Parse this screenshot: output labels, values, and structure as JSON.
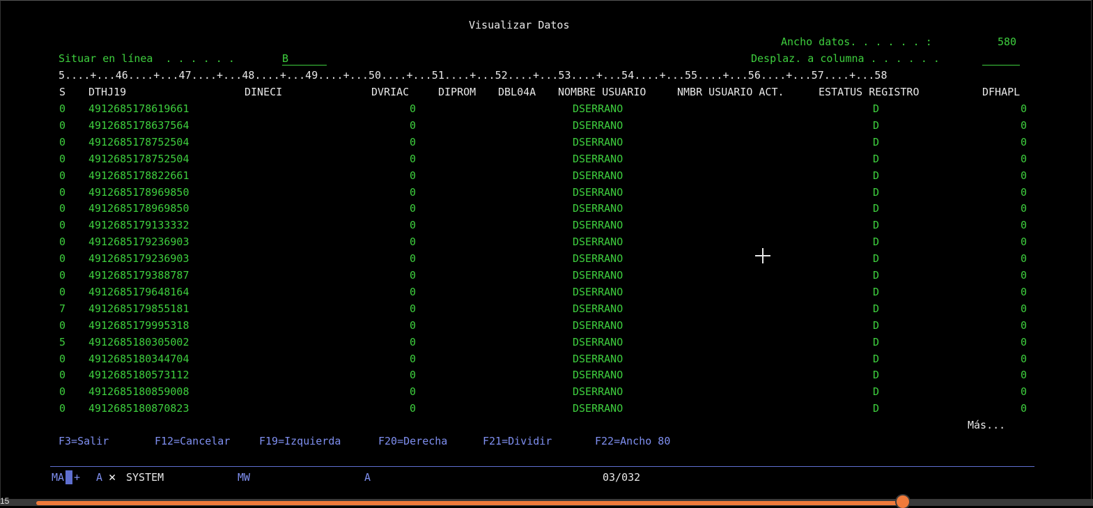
{
  "title": "Visualizar Datos",
  "ancho_label": "Ancho datos. . . . . . :",
  "ancho_value": "580",
  "situar_label": "Situar en línea  . . . . . .",
  "situar_value": "B",
  "desplaz_label": "Desplaz. a columna . . . . . .",
  "ruler": "5....+...46....+...47....+...48....+...49....+...50....+...51....+...52....+...53....+...54....+...55....+...56....+...57....+...58",
  "headers": [
    "S",
    "DTHJ19",
    "DINECI",
    "DVRIAC",
    "DIPROM",
    "DBL04A",
    "NOMBRE USUARIO",
    "NMBR USUARIO ACT.",
    "ESTATUS REGISTRO",
    "DFHAPL"
  ],
  "rows": [
    {
      "s": "0",
      "dthj": "4912685178619661",
      "dvriac": "0",
      "user": "DSERRANO",
      "estatus": "D",
      "dfhapl": "0"
    },
    {
      "s": "0",
      "dthj": "4912685178637564",
      "dvriac": "0",
      "user": "DSERRANO",
      "estatus": "D",
      "dfhapl": "0"
    },
    {
      "s": "0",
      "dthj": "4912685178752504",
      "dvriac": "0",
      "user": "DSERRANO",
      "estatus": "D",
      "dfhapl": "0"
    },
    {
      "s": "0",
      "dthj": "4912685178752504",
      "dvriac": "0",
      "user": "DSERRANO",
      "estatus": "D",
      "dfhapl": "0"
    },
    {
      "s": "0",
      "dthj": "4912685178822661",
      "dvriac": "0",
      "user": "DSERRANO",
      "estatus": "D",
      "dfhapl": "0"
    },
    {
      "s": "0",
      "dthj": "4912685178969850",
      "dvriac": "0",
      "user": "DSERRANO",
      "estatus": "D",
      "dfhapl": "0"
    },
    {
      "s": "0",
      "dthj": "4912685178969850",
      "dvriac": "0",
      "user": "DSERRANO",
      "estatus": "D",
      "dfhapl": "0"
    },
    {
      "s": "0",
      "dthj": "4912685179133332",
      "dvriac": "0",
      "user": "DSERRANO",
      "estatus": "D",
      "dfhapl": "0"
    },
    {
      "s": "0",
      "dthj": "4912685179236903",
      "dvriac": "0",
      "user": "DSERRANO",
      "estatus": "D",
      "dfhapl": "0"
    },
    {
      "s": "0",
      "dthj": "4912685179236903",
      "dvriac": "0",
      "user": "DSERRANO",
      "estatus": "D",
      "dfhapl": "0"
    },
    {
      "s": "0",
      "dthj": "4912685179388787",
      "dvriac": "0",
      "user": "DSERRANO",
      "estatus": "D",
      "dfhapl": "0"
    },
    {
      "s": "0",
      "dthj": "4912685179648164",
      "dvriac": "0",
      "user": "DSERRANO",
      "estatus": "D",
      "dfhapl": "0"
    },
    {
      "s": "7",
      "dthj": "4912685179855181",
      "dvriac": "0",
      "user": "DSERRANO",
      "estatus": "D",
      "dfhapl": "0"
    },
    {
      "s": "0",
      "dthj": "4912685179995318",
      "dvriac": "0",
      "user": "DSERRANO",
      "estatus": "D",
      "dfhapl": "0"
    },
    {
      "s": "5",
      "dthj": "4912685180305002",
      "dvriac": "0",
      "user": "DSERRANO",
      "estatus": "D",
      "dfhapl": "0"
    },
    {
      "s": "0",
      "dthj": "4912685180344704",
      "dvriac": "0",
      "user": "DSERRANO",
      "estatus": "D",
      "dfhapl": "0"
    },
    {
      "s": "0",
      "dthj": "4912685180573112",
      "dvriac": "0",
      "user": "DSERRANO",
      "estatus": "D",
      "dfhapl": "0"
    },
    {
      "s": "0",
      "dthj": "4912685180859008",
      "dvriac": "0",
      "user": "DSERRANO",
      "estatus": "D",
      "dfhapl": "0"
    },
    {
      "s": "0",
      "dthj": "4912685180870823",
      "dvriac": "0",
      "user": "DSERRANO",
      "estatus": "D",
      "dfhapl": "0"
    }
  ],
  "more": "Más...",
  "fkeys": [
    "F3=Salir",
    "F12=Cancelar",
    "F19=Izquierda",
    "F20=Derecha",
    "F21=Dividir",
    "F22=Ancho 80"
  ],
  "status": {
    "ma": "MA",
    "plus": "+",
    "a1": "A",
    "x": "✕",
    "system": "SYSTEM",
    "mw": "MW",
    "a2": "A",
    "pos": "03/032"
  },
  "video": {
    "time": "15",
    "progress": 0.82
  },
  "colors": {
    "green": "#3ecf3e",
    "white": "#e8e8e8",
    "blue": "#7f8ff0",
    "progress": "#f07a3a"
  }
}
